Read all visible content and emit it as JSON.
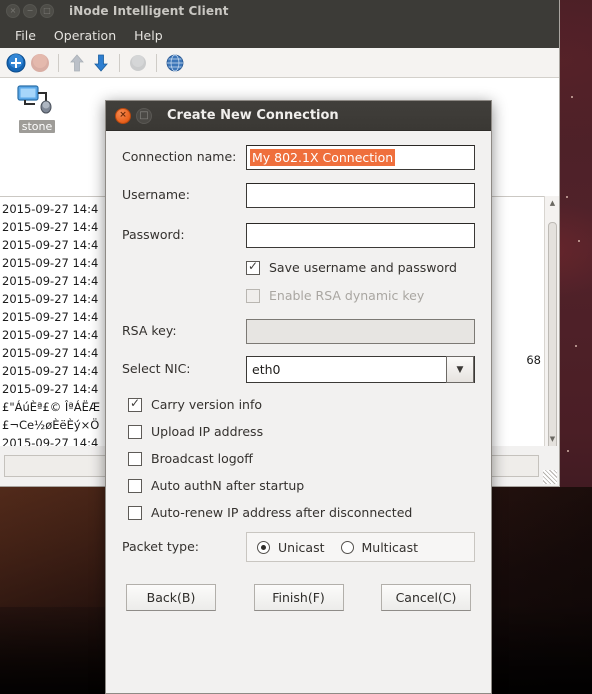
{
  "desktop": {
    "wallpaper_accent": "#4a1f26"
  },
  "main_window": {
    "title": "iNode Intelligent Client",
    "window_buttons": [
      {
        "name": "close",
        "glyph": "×"
      },
      {
        "name": "minimize",
        "glyph": "−"
      },
      {
        "name": "maximize",
        "glyph": "□"
      }
    ],
    "menu": [
      {
        "label": "File"
      },
      {
        "label": "Operation"
      },
      {
        "label": "Help"
      }
    ],
    "toolbar": [
      {
        "name": "add-connection-icon"
      },
      {
        "name": "delete-connection-icon"
      },
      {
        "name": "move-up-icon"
      },
      {
        "name": "move-down-icon"
      },
      {
        "name": "properties-icon"
      },
      {
        "name": "globe-icon"
      }
    ],
    "connection_item": {
      "icon": "network-connection-icon",
      "label": "stone"
    },
    "log_lines": [
      "2015-09-27 14:4",
      "2015-09-27 14:4",
      "2015-09-27 14:4",
      "2015-09-27 14:4",
      "2015-09-27 14:4",
      "2015-09-27 14:4",
      "2015-09-27 14:4",
      "2015-09-27 14:4",
      "2015-09-27 14:4",
      "2015-09-27 14:4",
      "2015-09-27 14:4",
      "£\"ÁúÈª£© ÎªÁËÆ",
      "£¬Ce½øÈëÈý×Ö",
      "2015-09-27 14:4"
    ],
    "truncated_text": "68",
    "scrollbar": {
      "up_arrow": "▲",
      "down_arrow": "▼"
    }
  },
  "dialog": {
    "title": "Create New Connection",
    "close_glyph": "×",
    "maximize_glyph": "□",
    "fields": {
      "connection_name": {
        "label": "Connection name:",
        "value": "My 802.1X Connection",
        "selected": true
      },
      "username": {
        "label": "Username:",
        "value": ""
      },
      "password": {
        "label": "Password:",
        "value": ""
      },
      "rsa_key": {
        "label": "RSA key:",
        "value": "",
        "disabled": true
      },
      "select_nic": {
        "label": "Select NIC:",
        "value": "eth0",
        "arrow": "▼"
      }
    },
    "checkboxes": [
      {
        "name": "save-username-and-password",
        "label": "Save username and password",
        "checked": true,
        "disabled": false,
        "indent": true
      },
      {
        "name": "enable-rsa-dynamic-key",
        "label": "Enable RSA dynamic key",
        "checked": false,
        "disabled": true,
        "indent": true
      }
    ],
    "options": [
      {
        "name": "carry-version-info",
        "label": "Carry version info",
        "checked": true
      },
      {
        "name": "upload-ip-address",
        "label": "Upload IP address",
        "checked": false
      },
      {
        "name": "broadcast-logoff",
        "label": "Broadcast logoff",
        "checked": false
      },
      {
        "name": "auto-authn-after-startup",
        "label": "Auto authN after startup",
        "checked": false
      },
      {
        "name": "auto-renew-ip-address",
        "label": "Auto-renew IP address after disconnected",
        "checked": false
      }
    ],
    "packet_type": {
      "label": "Packet type:",
      "options": [
        {
          "name": "unicast",
          "label": "Unicast",
          "selected": true
        },
        {
          "name": "multicast",
          "label": "Multicast",
          "selected": false
        }
      ]
    },
    "buttons": [
      {
        "name": "back-button",
        "label": "Back(B)"
      },
      {
        "name": "finish-button",
        "label": "Finish(F)"
      },
      {
        "name": "cancel-button",
        "label": "Cancel(C)"
      }
    ],
    "accent_selection_color": "#ef6f3c"
  }
}
